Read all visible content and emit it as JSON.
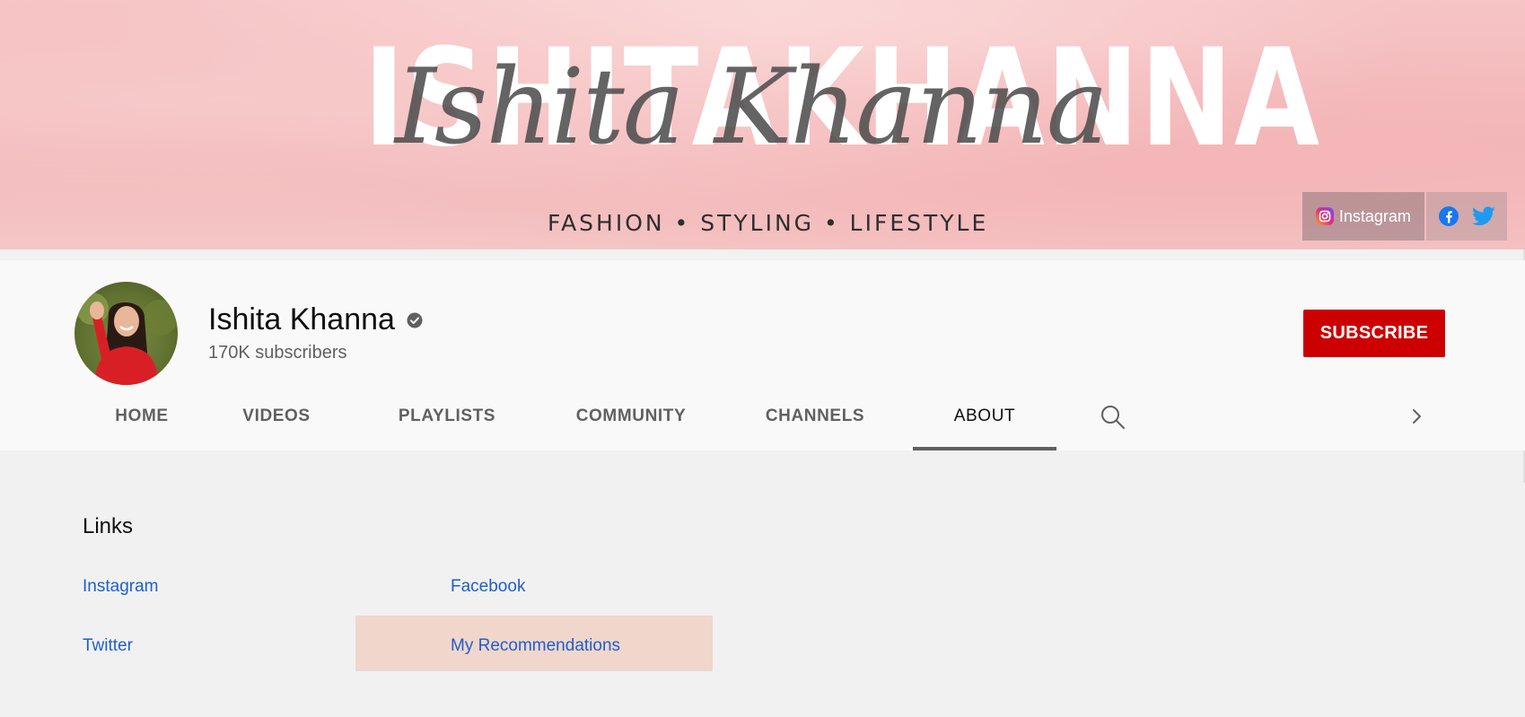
{
  "banner": {
    "block_words": [
      "ISHITA",
      "KHANNA"
    ],
    "script_text": "Ishita Khanna",
    "tagline": "FASHION • STYLING • LIFESTYLE",
    "links": {
      "instagram_label": "Instagram",
      "icons": [
        "facebook-icon",
        "twitter-icon"
      ]
    }
  },
  "channel": {
    "name": "Ishita Khanna",
    "subscribers": "170K subscribers",
    "verified": true,
    "subscribe_label": "SUBSCRIBE"
  },
  "tabs": [
    {
      "label": "HOME",
      "active": false
    },
    {
      "label": "VIDEOS",
      "active": false
    },
    {
      "label": "PLAYLISTS",
      "active": false
    },
    {
      "label": "COMMUNITY",
      "active": false
    },
    {
      "label": "CHANNELS",
      "active": false
    },
    {
      "label": "ABOUT",
      "active": true
    }
  ],
  "tab_icons": [
    "search-icon",
    "chevron-right-icon"
  ],
  "links_section": {
    "title": "Links",
    "items": [
      {
        "label": "Instagram"
      },
      {
        "label": "Facebook"
      },
      {
        "label": "Twitter"
      },
      {
        "label": "My Recommendations",
        "highlighted": true
      }
    ]
  },
  "colors": {
    "subscribe": "#cc0000",
    "link": "#1d5fcc",
    "highlight": "#f1d6cc",
    "active_tab_underline": "#606060"
  }
}
